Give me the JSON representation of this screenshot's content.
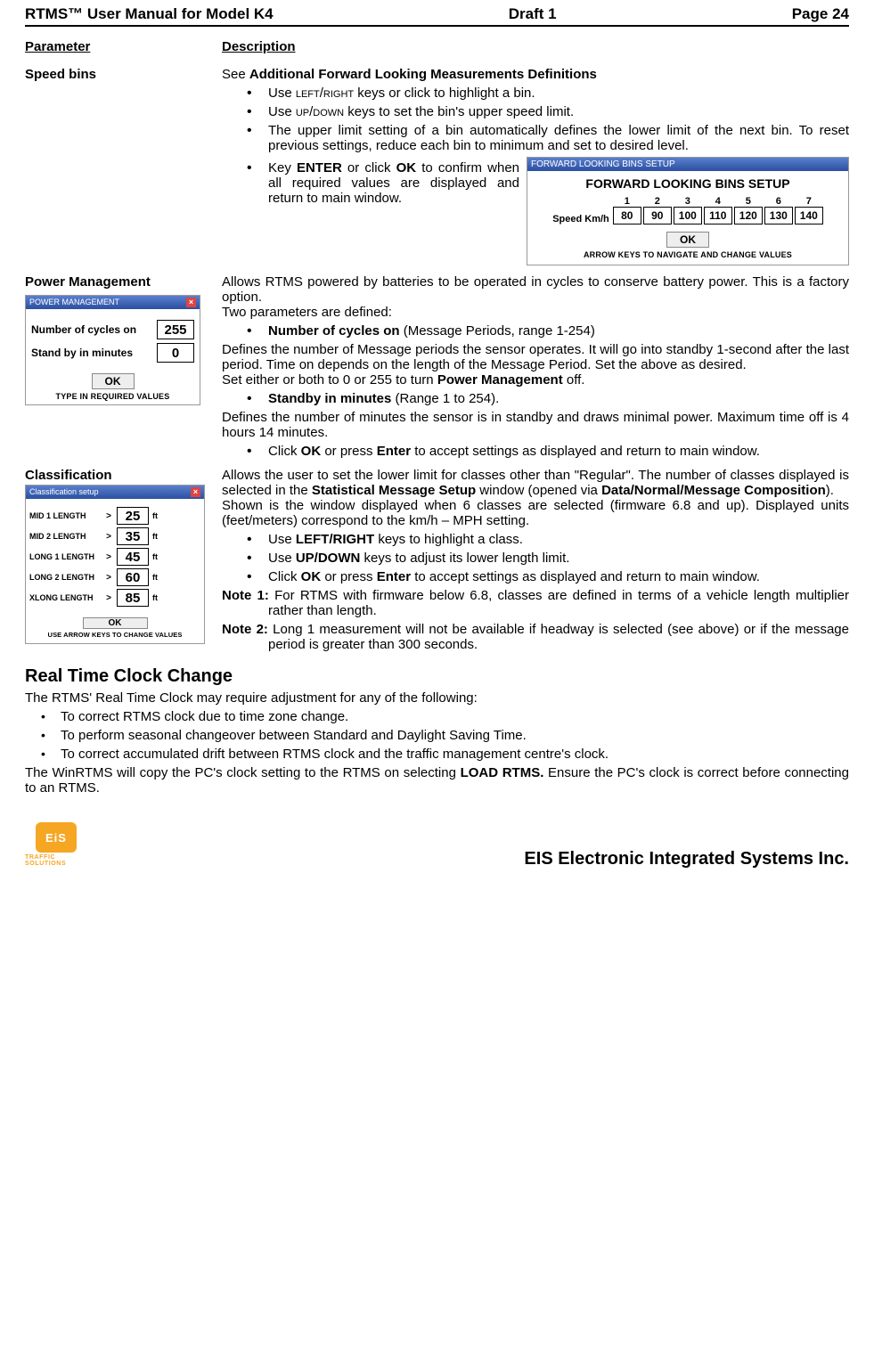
{
  "header": {
    "left": "RTMS™  User Manual for Model K4",
    "center": "Draft 1",
    "right": "Page 24"
  },
  "columns": {
    "param": "Parameter",
    "desc": "Description"
  },
  "speed": {
    "title": "Speed bins",
    "see_prefix": "See ",
    "see_bold": "Additional Forward Looking Measurements Definitions",
    "b1_pre": "Use ",
    "b1_keys": "left/right",
    "b1_post": " keys or click to highlight a bin.",
    "b2_pre": "Use ",
    "b2_keys": "up/down",
    "b2_post": " keys to set the bin's upper speed limit.",
    "b3": "The upper limit setting of a bin automatically defines the lower limit of the next bin.  To reset previous settings, reduce each bin to minimum and set to desired level.",
    "b4_pre": "Key ",
    "b4_enter": "ENTER",
    "b4_mid": " or click ",
    "b4_ok": "OK",
    "b4_post": " to confirm when all required values are displayed and return to main window."
  },
  "bins_fig": {
    "titlebar": "FORWARD LOOKING BINS SETUP",
    "heading": "FORWARD LOOKING BINS SETUP",
    "speed_label": "Speed Km/h",
    "cols": [
      "1",
      "2",
      "3",
      "4",
      "5",
      "6",
      "7"
    ],
    "vals": [
      "80",
      "90",
      "100",
      "110",
      "120",
      "130",
      "140"
    ],
    "ok": "OK",
    "hint": "ARROW KEYS TO NAVIGATE AND CHANGE VALUES"
  },
  "pm": {
    "title": "Power Management",
    "p1": "Allows RTMS powered by batteries to be operated in cycles to conserve battery power.  This is a factory option.",
    "p2": "Two parameters are defined:",
    "b1_bold": "Number of cycles on",
    "b1_rest": " (Message Periods, range 1-254)",
    "p3": "Defines the number of Message periods the sensor operates. It will go into standby 1-second after the last period. Time on depends on the length of the Message Period.   Set the above as desired.",
    "p4_pre": "Set either or both to 0 or 255 to turn ",
    "p4_bold": "Power Management",
    "p4_post": " off.",
    "b2_bold": "Standby in minutes",
    "b2_rest": " (Range 1 to 254).",
    "p5": "Defines the number of minutes the sensor is in standby and draws minimal power.  Maximum time off is 4 hours 14 minutes.",
    "b3_pre": "Click ",
    "b3_ok": "OK",
    "b3_mid": " or press ",
    "b3_enter": "Enter",
    "b3_post": " to accept settings as displayed and return to main window."
  },
  "pm_fig": {
    "titlebar": "POWER MANAGEMENT",
    "row1_label": "Number of cycles on",
    "row1_val": "255",
    "row2_label": "Stand by in minutes",
    "row2_val": "0",
    "ok": "OK",
    "hint": "TYPE IN REQUIRED VALUES"
  },
  "cls": {
    "title": "Classification",
    "p1_pre": "Allows the user to set the lower limit for classes other than \"Regular\". The number of classes displayed is selected in the ",
    "p1_bold": "Statistical Message Setup",
    "p1_mid": " window (opened via ",
    "p1_bold2": "Data/Normal/Message Composition",
    "p1_post": ").",
    "p2": "Shown is the window displayed when 6 classes are selected (firmware 6.8 and up).   Displayed units (feet/meters) correspond to the km/h – MPH setting.",
    "b1_pre": "Use ",
    "b1_bold": "LEFT/RIGHT",
    "b1_post": " keys to highlight a class.",
    "b2_pre": "Use ",
    "b2_bold": "UP/DOWN",
    "b2_post": " keys to adjust its lower length limit.",
    "b3_pre": "Click ",
    "b3_ok": "OK",
    "b3_mid": " or press ",
    "b3_enter": "Enter",
    "b3_post": " to accept settings as displayed and return to main window.",
    "n1_label": "Note 1:",
    "n1_text": "  For RTMS with firmware below 6.8, classes are defined in terms of a vehicle length multiplier rather than length.",
    "n2_label": "Note 2:",
    "n2_text": " Long 1 measurement will not be available if headway is selected (see above) or if the message period is greater than 300 seconds."
  },
  "cls_fig": {
    "titlebar": "Classification setup",
    "rows": [
      {
        "label": "MID 1 LENGTH",
        "val": "25",
        "unit": "ft"
      },
      {
        "label": "MID 2 LENGTH",
        "val": "35",
        "unit": "ft"
      },
      {
        "label": "LONG 1 LENGTH",
        "val": "45",
        "unit": "ft"
      },
      {
        "label": "LONG 2 LENGTH",
        "val": "60",
        "unit": "ft"
      },
      {
        "label": "XLONG LENGTH",
        "val": "85",
        "unit": "ft"
      }
    ],
    "gt": ">",
    "ok": "OK",
    "hint": "USE ARROW KEYS TO CHANGE VALUES"
  },
  "rtc": {
    "heading": "Real Time Clock Change",
    "intro": "The RTMS' Real Time Clock may require adjustment for any of the following:",
    "b1": "To correct RTMS clock due to time zone change.",
    "b2": "To perform seasonal changeover between Standard and Daylight Saving Time.",
    "b3": "To correct accumulated drift between RTMS clock and the traffic management centre's clock.",
    "out_pre": "The WinRTMS will copy the PC's clock setting to the RTMS on selecting ",
    "out_bold": "LOAD RTMS.",
    "out_post": "  Ensure the PC's clock is correct before connecting to an RTMS."
  },
  "footer": {
    "company": "EIS Electronic Integrated Systems Inc.",
    "logo_text": "EiS",
    "logo_sub": "TRAFFIC SOLUTIONS"
  }
}
